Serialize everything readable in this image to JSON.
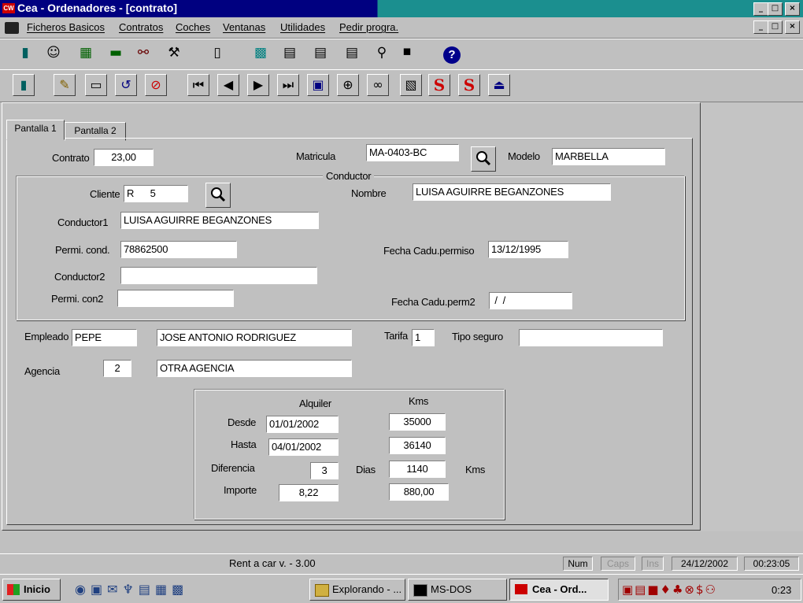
{
  "window": {
    "title": "Cea - Ordenadores - [contrato]",
    "minimize": "_",
    "maximize": "□",
    "close": "×"
  },
  "menu": [
    "Ficheros Basicos",
    "Contratos",
    "Coches",
    "Ventanas",
    "Utilidades",
    "Pedir progra."
  ],
  "tabs": [
    "Pantalla 1",
    "Pantalla 2"
  ],
  "form": {
    "contrato": {
      "label": "Contrato",
      "value": "23,00"
    },
    "matricula": {
      "label": "Matricula",
      "value": "MA-0403-BC"
    },
    "modelo": {
      "label": "Modelo",
      "value": "MARBELLA"
    },
    "conductor_group": "Conductor",
    "cliente": {
      "label": "Cliente",
      "value": "R      5"
    },
    "nombre": {
      "label": "Nombre",
      "value": "LUISA AGUIRRE BEGANZONES"
    },
    "conductor1": {
      "label": "Conductor1",
      "value": "LUISA AGUIRRE BEGANZONES"
    },
    "permi_cond": {
      "label": "Permi. cond.",
      "value": "78862500"
    },
    "fecha_cadu_permiso": {
      "label": "Fecha Cadu.permiso",
      "value": "13/12/1995"
    },
    "conductor2": {
      "label": "Conductor2",
      "value": ""
    },
    "permi_con2": {
      "label": "Permi. con2",
      "value": ""
    },
    "fecha_cadu_perm2": {
      "label": "Fecha Cadu.perm2",
      "value": " /  / "
    },
    "empleado": {
      "label": "Empleado",
      "code": "PEPE",
      "name": "JOSE ANTONIO RODRIGUEZ"
    },
    "tarifa": {
      "label": "Tarifa",
      "value": "1"
    },
    "tipo_seguro": {
      "label": "Tipo seguro",
      "value": ""
    },
    "agencia": {
      "label": "Agencia",
      "code": "2",
      "name": "OTRA AGENCIA"
    }
  },
  "rental": {
    "col_alquiler": "Alquiler",
    "col_kms": "Kms",
    "desde": {
      "label": "Desde",
      "date": "01/01/2002",
      "kms": "35000"
    },
    "hasta": {
      "label": "Hasta",
      "date": "04/01/2002",
      "kms": "36140"
    },
    "diferencia": {
      "label": "Diferencia",
      "days": "3",
      "days_label": "Dias",
      "kms": "1140",
      "kms_label": "Kms"
    },
    "importe": {
      "label": "Importe",
      "alquiler": "8,22",
      "kms": "880,00"
    }
  },
  "status": {
    "app": "Rent a car  v. - 3.00",
    "num": "Num",
    "caps": "Caps",
    "ins": "Ins",
    "date": "24/12/2002",
    "time": "00:23:05"
  },
  "taskbar": {
    "start": "Inicio",
    "tasks": [
      "Explorando - ...",
      "MS-DOS",
      "Cea - Ord..."
    ],
    "clock": "0:23"
  },
  "colors": {
    "titlebar": "#000080",
    "face": "#c0c0c0",
    "field": "#ffffff"
  }
}
